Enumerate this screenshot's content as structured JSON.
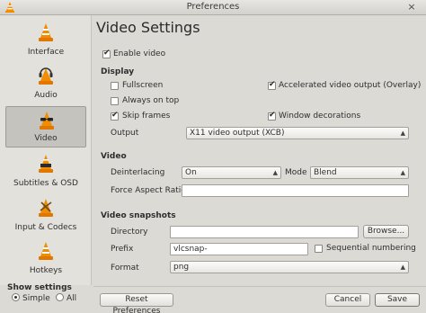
{
  "window": {
    "title": "Preferences",
    "close_glyph": "×"
  },
  "sidebar": {
    "items": [
      {
        "label": "Interface",
        "icon": "vlc-cone-icon"
      },
      {
        "label": "Audio",
        "icon": "headphones-cone-icon"
      },
      {
        "label": "Video",
        "icon": "glasses-cone-icon",
        "selected": true
      },
      {
        "label": "Subtitles & OSD",
        "icon": "subtitles-cone-icon"
      },
      {
        "label": "Input & Codecs",
        "icon": "codecs-cone-icon"
      },
      {
        "label": "Hotkeys",
        "icon": "hotkeys-cone-icon"
      }
    ],
    "show_settings": {
      "label": "Show settings",
      "simple": "Simple",
      "all": "All",
      "selected": "Simple"
    }
  },
  "main": {
    "heading": "Video Settings",
    "enable_video": {
      "label": "Enable video",
      "checked": true
    },
    "display": {
      "section": "Display",
      "fullscreen": {
        "label": "Fullscreen",
        "checked": false
      },
      "always_on_top": {
        "label": "Always on top",
        "checked": false
      },
      "skip_frames": {
        "label": "Skip frames",
        "checked": true
      },
      "accelerated": {
        "label": "Accelerated video output (Overlay)",
        "checked": true
      },
      "window_decorations": {
        "label": "Window decorations",
        "checked": true
      },
      "output_label": "Output",
      "output_value": "X11 video output (XCB)"
    },
    "video": {
      "section": "Video",
      "deinterlacing_label": "Deinterlacing",
      "deinterlacing_value": "On",
      "mode_label": "Mode",
      "mode_value": "Blend",
      "force_aspect_label": "Force Aspect Ratio",
      "force_aspect_value": ""
    },
    "snapshots": {
      "section": "Video snapshots",
      "directory_label": "Directory",
      "directory_value": "",
      "browse_label": "Browse...",
      "prefix_label": "Prefix",
      "prefix_value": "vlcsnap-",
      "sequential": {
        "label": "Sequential numbering",
        "checked": false
      },
      "format_label": "Format",
      "format_value": "png"
    }
  },
  "footer": {
    "reset_label": "Reset Preferences",
    "cancel_label": "Cancel",
    "save_label": "Save"
  },
  "colors": {
    "cone_orange": "#f28c00",
    "selected_bg": "#c5c3be"
  }
}
